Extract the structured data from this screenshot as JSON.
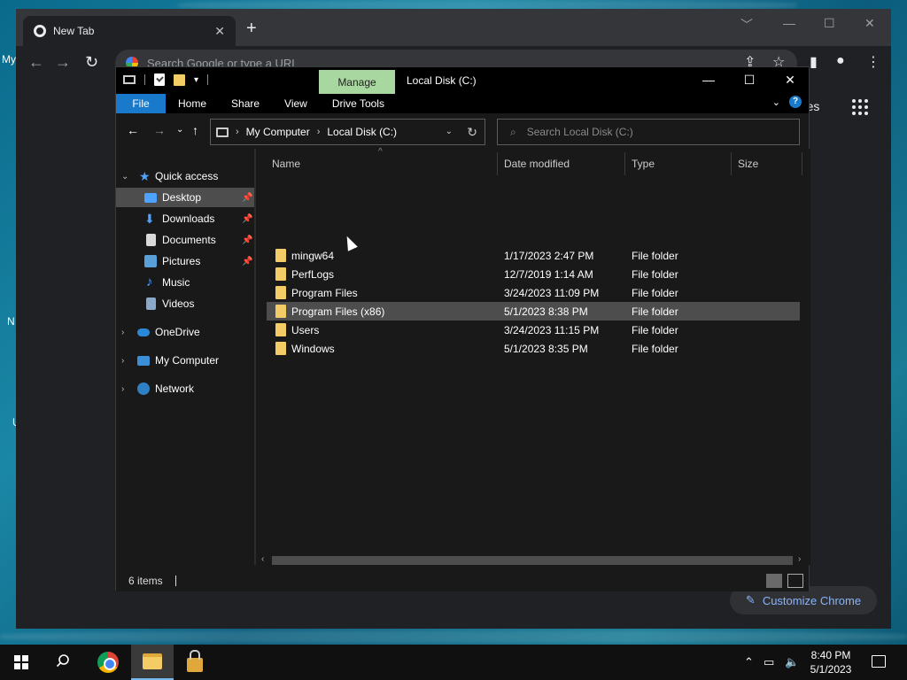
{
  "desktop": {
    "labels": [
      "My",
      "N",
      "U"
    ]
  },
  "chrome": {
    "tab_title": "New Tab",
    "tab_close": "✕",
    "new_tab": "+",
    "omnibox_placeholder": "Search Google or type a URL",
    "images_link": "ages",
    "customize_label": "Customize Chrome",
    "win_min": "﹀",
    "win_minimize": "—",
    "win_maximize": "☐",
    "win_close": "✕"
  },
  "explorer": {
    "manage_tab": "Manage",
    "title": "Local Disk (C:)",
    "ribbon_tabs": [
      "File",
      "Home",
      "Share",
      "View",
      "Drive Tools"
    ],
    "address": {
      "crumbs": [
        "My Computer",
        "Local Disk (C:)"
      ]
    },
    "search_placeholder": "Search Local Disk (C:)",
    "nav_pane": [
      {
        "label": "Quick access",
        "pinned": false
      },
      {
        "label": "Desktop",
        "pinned": true
      },
      {
        "label": "Downloads",
        "pinned": true
      },
      {
        "label": "Documents",
        "pinned": true
      },
      {
        "label": "Pictures",
        "pinned": true
      },
      {
        "label": "Music",
        "pinned": false
      },
      {
        "label": "Videos",
        "pinned": false
      },
      {
        "label": "OneDrive",
        "pinned": false
      },
      {
        "label": "My Computer",
        "pinned": false
      },
      {
        "label": "Network",
        "pinned": false
      }
    ],
    "columns": [
      "Name",
      "Date modified",
      "Type",
      "Size"
    ],
    "files": [
      {
        "name": "mingw64",
        "date": "1/17/2023 2:47 PM",
        "type": "File folder"
      },
      {
        "name": "PerfLogs",
        "date": "12/7/2019 1:14 AM",
        "type": "File folder"
      },
      {
        "name": "Program Files",
        "date": "3/24/2023 11:09 PM",
        "type": "File folder"
      },
      {
        "name": "Program Files (x86)",
        "date": "5/1/2023 8:38 PM",
        "type": "File folder"
      },
      {
        "name": "Users",
        "date": "3/24/2023 11:15 PM",
        "type": "File folder"
      },
      {
        "name": "Windows",
        "date": "5/1/2023 8:35 PM",
        "type": "File folder"
      }
    ],
    "status_text": "6 items"
  },
  "taskbar": {
    "time": "8:40 PM",
    "date": "5/1/2023"
  }
}
